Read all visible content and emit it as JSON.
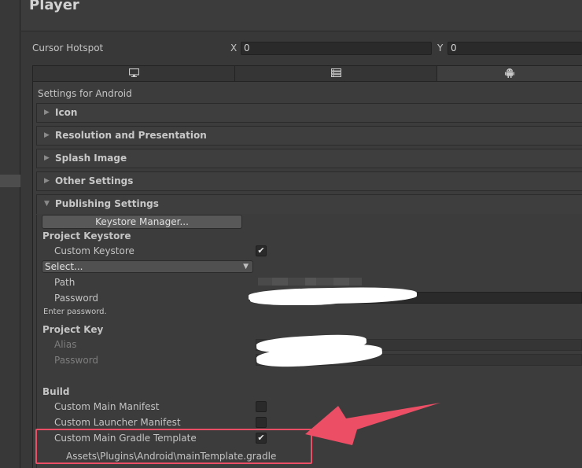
{
  "header": {
    "title": "Player"
  },
  "cursor_hotspot": {
    "label": "Cursor Hotspot",
    "x_label": "X",
    "x_value": "0",
    "y_label": "Y",
    "y_value": "0"
  },
  "platform_tabs": [
    {
      "icon": "monitor-icon",
      "selected": false
    },
    {
      "icon": "server-icon",
      "selected": false
    },
    {
      "icon": "android-icon",
      "selected": true
    }
  ],
  "settings_title": "Settings for Android",
  "sections": {
    "icon": "Icon",
    "resolution": "Resolution and Presentation",
    "splash": "Splash Image",
    "other": "Other Settings",
    "publishing": "Publishing Settings"
  },
  "publishing": {
    "keystore_manager_button": "Keystore Manager...",
    "project_keystore_heading": "Project Keystore",
    "custom_keystore_label": "Custom Keystore",
    "custom_keystore_checked": true,
    "keystore_select_value": "Select...",
    "path_label": "Path",
    "password_label": "Password",
    "enter_password_hint": "Enter password.",
    "project_key_heading": "Project Key",
    "alias_label": "Alias",
    "key_password_label": "Password",
    "build_heading": "Build",
    "custom_main_manifest_label": "Custom Main Manifest",
    "custom_main_manifest_checked": false,
    "custom_launcher_manifest_label": "Custom Launcher Manifest",
    "custom_launcher_manifest_checked": false,
    "custom_main_gradle_label": "Custom Main Gradle Template",
    "custom_main_gradle_checked": true,
    "gradle_path": "Assets\\Plugins\\Android\\mainTemplate.gradle"
  },
  "colors": {
    "background": "#383838",
    "panel": "#3c3c3c",
    "field": "#2a2a2a",
    "annotation": "#ec4e66"
  }
}
